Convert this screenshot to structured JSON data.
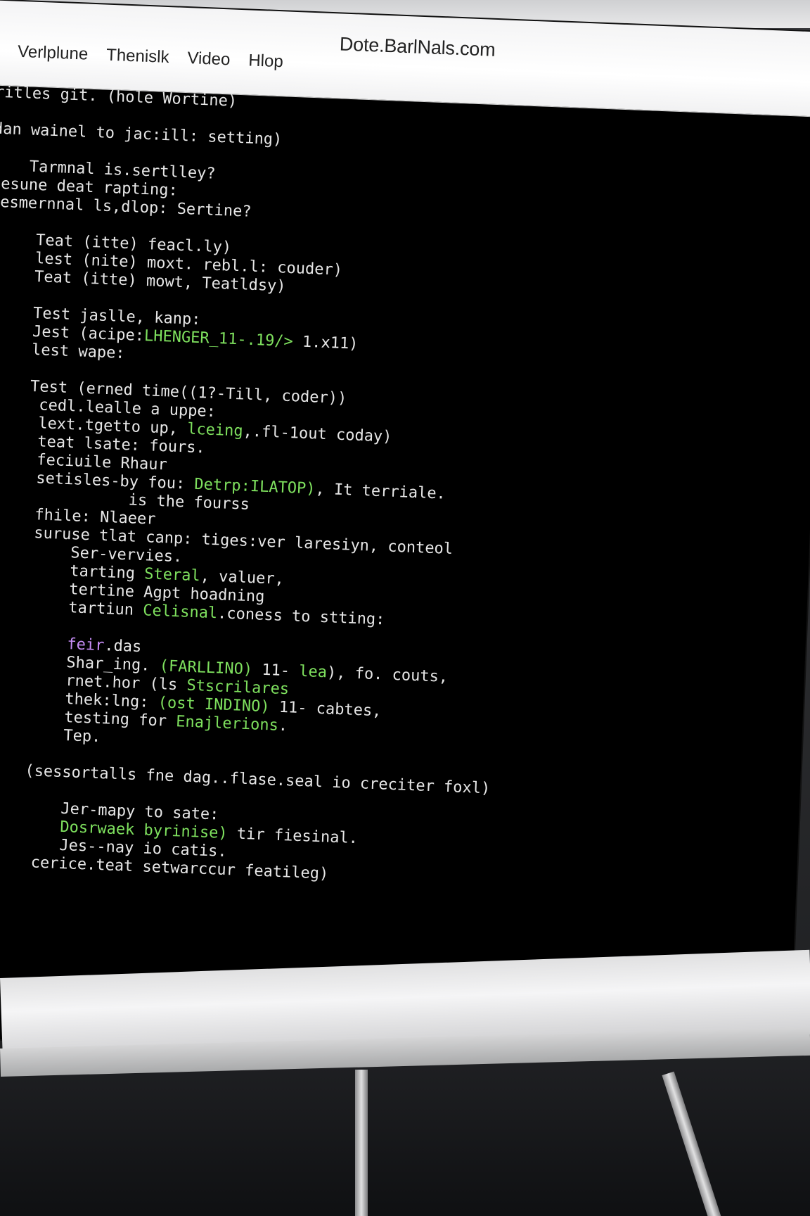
{
  "window": {
    "title": "Dote.BarlNals.com",
    "menu": [
      "Verlplune",
      "Thenislk",
      "Video",
      "Hlop"
    ]
  },
  "terminal": {
    "lines": [
      [
        {
          "t": "ritles git. (hole Wortine)",
          "c": "w"
        }
      ],
      [
        {
          "t": "",
          "c": "w"
        }
      ],
      [
        {
          "t": "dan wainel to jac:ill: setting)",
          "c": "w"
        }
      ],
      [
        {
          "t": "",
          "c": "w"
        }
      ],
      [
        {
          "t": "    Tarmnal is.sertlley?",
          "c": "w"
        }
      ],
      [
        {
          "t": "lesune deat rapting:",
          "c": "w"
        }
      ],
      [
        {
          "t": "fesmernnal ls,dlop: Sertine?",
          "c": "w"
        }
      ],
      [
        {
          "t": "",
          "c": "w"
        }
      ],
      [
        {
          "t": "     Teat (itte) feacl.ly)",
          "c": "w"
        }
      ],
      [
        {
          "t": "     lest (nite) moxt. rebl.l: couder)",
          "c": "w"
        }
      ],
      [
        {
          "t": "     Teat (itte) mowt, Teatldsy)",
          "c": "w"
        }
      ],
      [
        {
          "t": "",
          "c": "w"
        }
      ],
      [
        {
          "t": "     Test jaslle, kanp:",
          "c": "w"
        }
      ],
      [
        {
          "t": "     Jest (acipe:",
          "c": "w"
        },
        {
          "t": "LHENGER_11-.19/>",
          "c": "g"
        },
        {
          "t": " 1.x11)",
          "c": "w"
        }
      ],
      [
        {
          "t": "     lest wape:",
          "c": "w"
        }
      ],
      [
        {
          "t": "",
          "c": "w"
        }
      ],
      [
        {
          "t": "     Test (erned time((1?-Till, coder))",
          "c": "w"
        }
      ],
      [
        {
          "t": "      cedl.lealle a uppe:",
          "c": "w"
        }
      ],
      [
        {
          "t": "      lext.tgetto up, ",
          "c": "w"
        },
        {
          "t": "lceing",
          "c": "g"
        },
        {
          "t": ",.fl-1out coday)",
          "c": "w"
        }
      ],
      [
        {
          "t": "      teat lsate: fours.",
          "c": "w"
        }
      ],
      [
        {
          "t": "      feciuile Rhaur",
          "c": "w"
        }
      ],
      [
        {
          "t": "      setisles-by fou: ",
          "c": "w"
        },
        {
          "t": "Detrp:ILATOP)",
          "c": "g"
        },
        {
          "t": ", It terriale.",
          "c": "w"
        }
      ],
      [
        {
          "t": "                is the fourss",
          "c": "w"
        }
      ],
      [
        {
          "t": "      fhile: Nlaeer",
          "c": "w"
        }
      ],
      [
        {
          "t": "      suruse tlat canp: tiges:ver laresiyn, conteol",
          "c": "w"
        }
      ],
      [
        {
          "t": "          Ser-vervies.",
          "c": "w"
        }
      ],
      [
        {
          "t": "          tarting ",
          "c": "w"
        },
        {
          "t": "Steral",
          "c": "g"
        },
        {
          "t": ", valuer,",
          "c": "w"
        }
      ],
      [
        {
          "t": "          tertine Agpt hoadning",
          "c": "w"
        }
      ],
      [
        {
          "t": "          tartiun ",
          "c": "w"
        },
        {
          "t": "Celisnal",
          "c": "g"
        },
        {
          "t": ".coness to stting:",
          "c": "w"
        }
      ],
      [
        {
          "t": "",
          "c": "w"
        }
      ],
      [
        {
          "t": "          ",
          "c": "w"
        },
        {
          "t": "feir",
          "c": "p"
        },
        {
          "t": ".das",
          "c": "w"
        }
      ],
      [
        {
          "t": "          Shar_ing. ",
          "c": "w"
        },
        {
          "t": "(FARLLINO)",
          "c": "g"
        },
        {
          "t": " 11- ",
          "c": "w"
        },
        {
          "t": "lea",
          "c": "g"
        },
        {
          "t": "), fo. couts,",
          "c": "w"
        }
      ],
      [
        {
          "t": "          rnet.hor (ls ",
          "c": "w"
        },
        {
          "t": "Stscrilares",
          "c": "g"
        }
      ],
      [
        {
          "t": "          thek:lng: ",
          "c": "w"
        },
        {
          "t": "(ost INDINO)",
          "c": "g"
        },
        {
          "t": " 11- cabtes,",
          "c": "w"
        }
      ],
      [
        {
          "t": "          testing for ",
          "c": "w"
        },
        {
          "t": "Enajlerions",
          "c": "g"
        },
        {
          "t": ".",
          "c": "w"
        }
      ],
      [
        {
          "t": "          Tep.",
          "c": "w"
        }
      ],
      [
        {
          "t": "",
          "c": "w"
        }
      ],
      [
        {
          "t": "      (sessortalls fne dag..flase.seal io creciter foxl)",
          "c": "w"
        }
      ],
      [
        {
          "t": "",
          "c": "w"
        }
      ],
      [
        {
          "t": "          Jer-mapy to sate:",
          "c": "w"
        }
      ],
      [
        {
          "t": "          ",
          "c": "w"
        },
        {
          "t": "Dosrwaek byrinise)",
          "c": "g"
        },
        {
          "t": " tir fiesinal.",
          "c": "w"
        }
      ],
      [
        {
          "t": "          Jes--nay io catis.",
          "c": "w"
        }
      ],
      [
        {
          "t": "       cerice.teat setwarccur featileg)",
          "c": "w"
        }
      ]
    ]
  }
}
